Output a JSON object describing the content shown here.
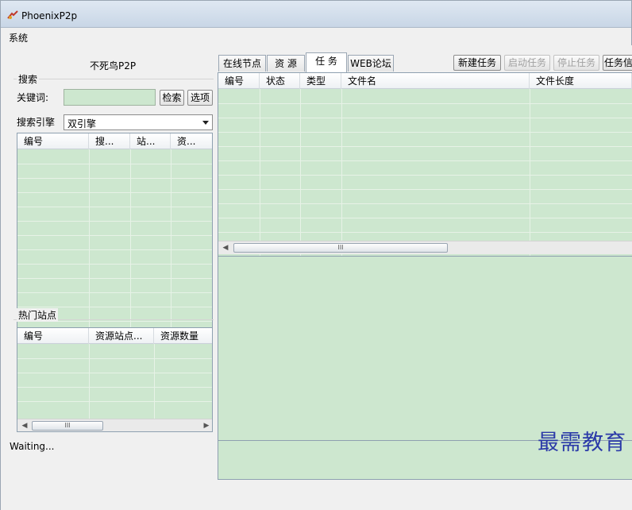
{
  "window": {
    "title": "PhoenixP2p",
    "icon": "phoenix-app-icon"
  },
  "menu": {
    "items": [
      "系统"
    ]
  },
  "sidebar": {
    "title": "不死鸟P2P",
    "search_group_label": "搜索",
    "keyword_label": "关键词:",
    "keyword_value": "",
    "search_button": "检索",
    "options_button": "选项",
    "engine_label": "搜索引擎",
    "engine_value": "双引擎",
    "results_headers": [
      "编号",
      "搜...",
      "站...",
      "资..."
    ],
    "hot_sites_label": "热门站点",
    "hot_sites_headers": [
      "编号",
      "资源站点...",
      "资源数量"
    ]
  },
  "status": {
    "text": "Waiting..."
  },
  "tabs": [
    {
      "label": "在线节点",
      "active": false
    },
    {
      "label": "资  源",
      "active": false
    },
    {
      "label": "任  务",
      "active": true
    },
    {
      "label": "WEB论坛",
      "active": false
    }
  ],
  "toolbar": {
    "new_task": "新建任务",
    "start_task": "启动任务",
    "stop_task": "停止任务",
    "task_info": "任务信"
  },
  "task_table": {
    "headers": [
      "编号",
      "状态",
      "类型",
      "文件名",
      "文件长度"
    ]
  },
  "scroll_mark": "III",
  "watermark": "最需教育",
  "colors": {
    "table_bg": "#cde7cf",
    "window_bg": "#f0f0f0",
    "border": "#8ea0b0",
    "watermark": "#2b3aa8"
  }
}
